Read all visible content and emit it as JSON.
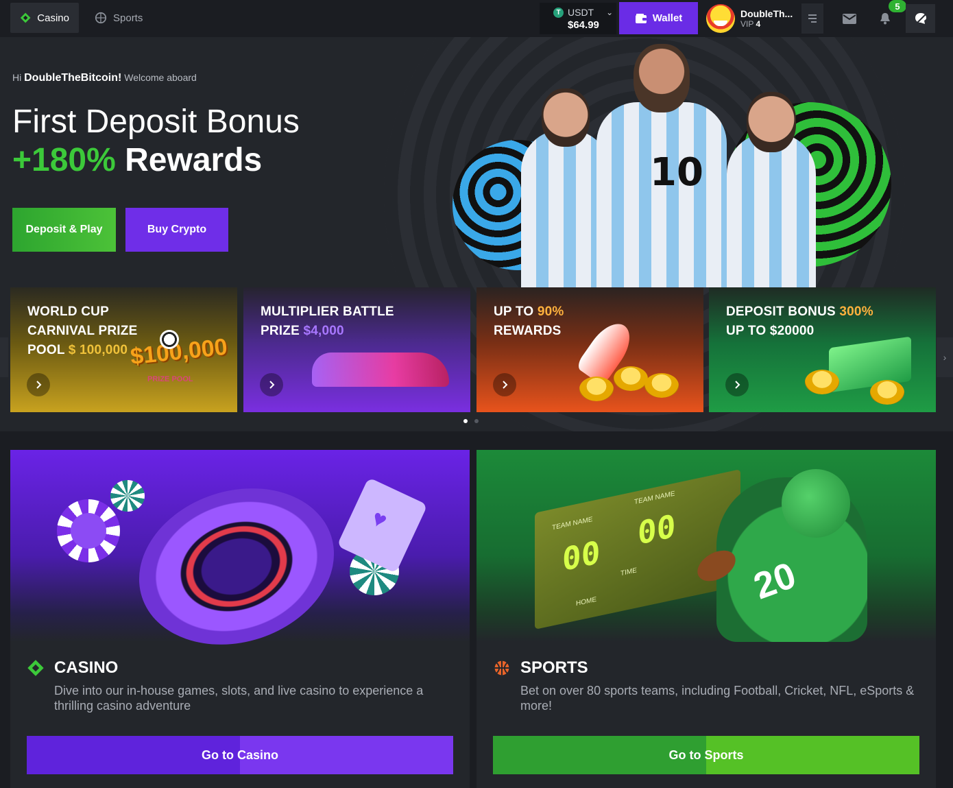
{
  "nav": {
    "casino_label": "Casino",
    "sports_label": "Sports",
    "currency": "USDT",
    "currency_icon": "T",
    "balance": "$64.99",
    "wallet_label": "Wallet",
    "username": "DoubleTh...",
    "vip_prefix": "VIP",
    "vip_level": "4",
    "notification_count": "5"
  },
  "hero": {
    "greet_hi": "Hi",
    "greet_name": "DoubleTheBitcoin!",
    "greet_suffix": "Welcome aboard",
    "title": "First Deposit Bonus",
    "bonus_pct": "+180%",
    "bonus_word": "Rewards",
    "deposit_label": "Deposit & Play",
    "crypto_label": "Buy Crypto",
    "jersey_number": "10"
  },
  "promos": [
    {
      "line1": "WORLD CUP",
      "line2": "CARNIVAL PRIZE",
      "line3a": "POOL",
      "line3b": "$ 100,000",
      "art_amount": "$100,000",
      "art_sub": "PRIZE POOL"
    },
    {
      "line1": "MULTIPLIER BATTLE",
      "line2a": "PRIZE",
      "line2b": "$4,000"
    },
    {
      "line1a": "UP TO",
      "line1b": "90%",
      "line2": "REWARDS"
    },
    {
      "line1a": "DEPOSIT BONUS",
      "line1b": "300%",
      "line2": "UP TO $20000"
    }
  ],
  "sections": {
    "casino": {
      "title": "CASINO",
      "desc": "Dive into our in-house games, slots, and live casino to experience a thrilling casino adventure",
      "button": "Go to Casino"
    },
    "sports": {
      "title": "SPORTS",
      "desc": "Bet on over 80 sports teams, including Football, Cricket, NFL, eSports & more!",
      "button": "Go to Sports",
      "board_team": "TEAM NAME",
      "board_score": "00",
      "board_time": "TIME",
      "board_home": "HOME",
      "athlete_number": "20"
    }
  },
  "colors": {
    "accent_green": "#3cc93a",
    "accent_purple": "#6a2ce6",
    "bg": "#1b1d22"
  },
  "icons": [
    "casino-diamond-icon",
    "sports-ball-icon",
    "wallet-icon",
    "menu-icon",
    "mail-icon",
    "bell-icon",
    "chat-icon",
    "chevron-right-icon",
    "chevron-down-icon"
  ]
}
